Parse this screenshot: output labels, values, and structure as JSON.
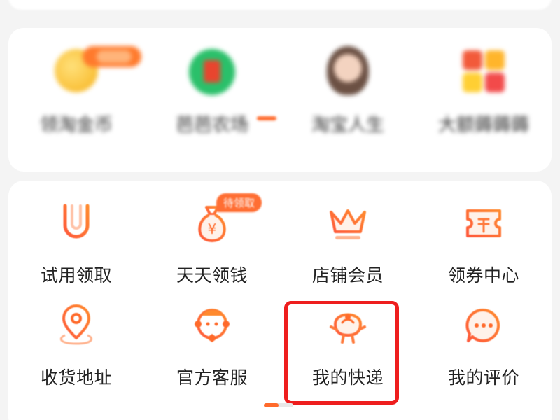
{
  "top_row": [
    {
      "label": "领淘金币",
      "icon": "gold-coin-icon"
    },
    {
      "label": "芭芭农场",
      "icon": "farm-icon"
    },
    {
      "label": "淘宝人生",
      "icon": "avatar-icon"
    },
    {
      "label": "大额薅薅薅",
      "icon": "blocks-icon"
    }
  ],
  "grid": [
    {
      "label": "试用领取",
      "icon": "u-magnet-icon"
    },
    {
      "label": "天天领钱",
      "icon": "money-bag-icon",
      "badge": "待领取"
    },
    {
      "label": "店铺会员",
      "icon": "crown-icon"
    },
    {
      "label": "领券中心",
      "icon": "coupon-icon"
    },
    {
      "label": "收货地址",
      "icon": "location-pin-icon"
    },
    {
      "label": "官方客服",
      "icon": "customer-service-icon"
    },
    {
      "label": "我的快递",
      "icon": "courier-bird-icon"
    },
    {
      "label": "我的评价",
      "icon": "chat-bubble-icon"
    }
  ],
  "colors": {
    "accent": "#ff6a2b",
    "icon_gradient_start": "#ff5a3c",
    "icon_gradient_end": "#ff8a2e",
    "highlight": "#ee1e1e"
  }
}
